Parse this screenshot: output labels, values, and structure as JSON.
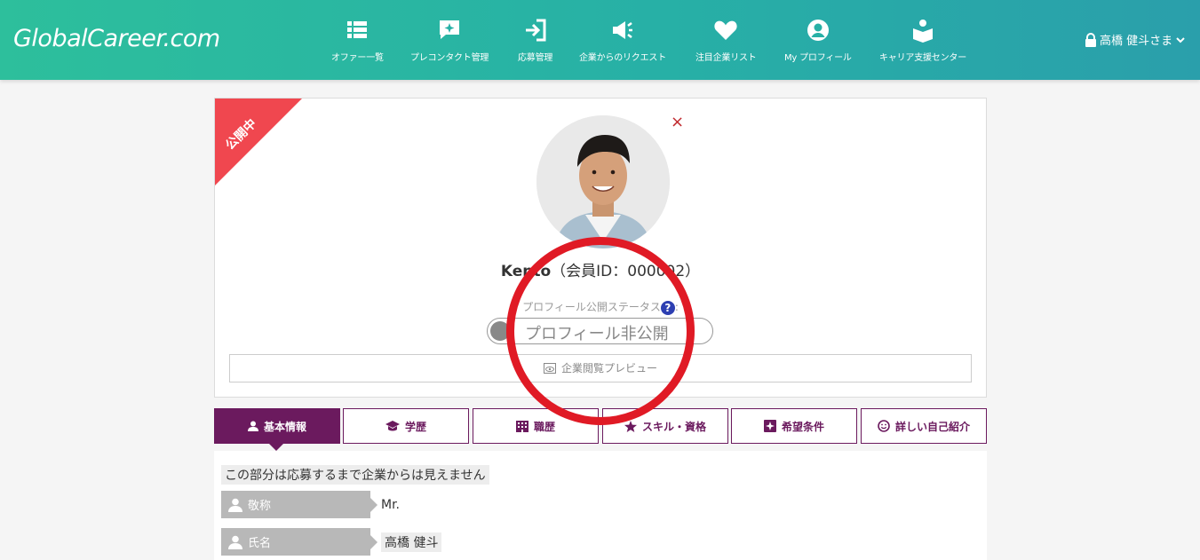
{
  "app": {
    "logo": "GlobalCareer.com"
  },
  "nav": [
    {
      "label": "オファー一覧",
      "icon": "list-icon"
    },
    {
      "label": "プレコンタクト管理",
      "icon": "chat-sparkle-icon"
    },
    {
      "label": "応募管理",
      "icon": "login-arrow-icon"
    },
    {
      "label": "企業からのリクエスト",
      "icon": "megaphone-icon"
    },
    {
      "label": "注目企業リスト",
      "icon": "heart-icon"
    },
    {
      "label": "My プロフィール",
      "icon": "user-circle-icon"
    },
    {
      "label": "キャリア支援センター",
      "icon": "reading-person-icon"
    }
  ],
  "user": {
    "label": "高橋 健斗さま",
    "icon": "lock-icon"
  },
  "profile": {
    "ribbon": "公開中",
    "close": "×",
    "name": "Kento",
    "member_id": "（会員ID：000002）",
    "status_label": "プロフィール公開ステータス",
    "help": "?",
    "colon": ":",
    "toggle_text": "プロフィール非公開",
    "preview_button": "企業閲覧プレビュー"
  },
  "tabs": [
    {
      "label": "基本情報",
      "icon": "person-icon",
      "active": true
    },
    {
      "label": "学歴",
      "icon": "graduation-cap-icon",
      "active": false
    },
    {
      "label": "職歴",
      "icon": "building-icon",
      "active": false
    },
    {
      "label": "スキル・資格",
      "icon": "star-icon",
      "active": false
    },
    {
      "label": "希望条件",
      "icon": "sparkle-badge-icon",
      "active": false
    },
    {
      "label": "詳しい自己紹介",
      "icon": "smile-icon",
      "active": false
    }
  ],
  "basic": {
    "notice": "この部分は応募するまで企業からは見えません",
    "fields": [
      {
        "label": "敬称",
        "value": "Mr."
      },
      {
        "label": "氏名",
        "value": "高橋 健斗"
      }
    ]
  },
  "colors": {
    "header": "#27b0a6",
    "accent": "#6b1a5e",
    "ribbon": "#f0474f",
    "annotation": "#e01a25"
  }
}
